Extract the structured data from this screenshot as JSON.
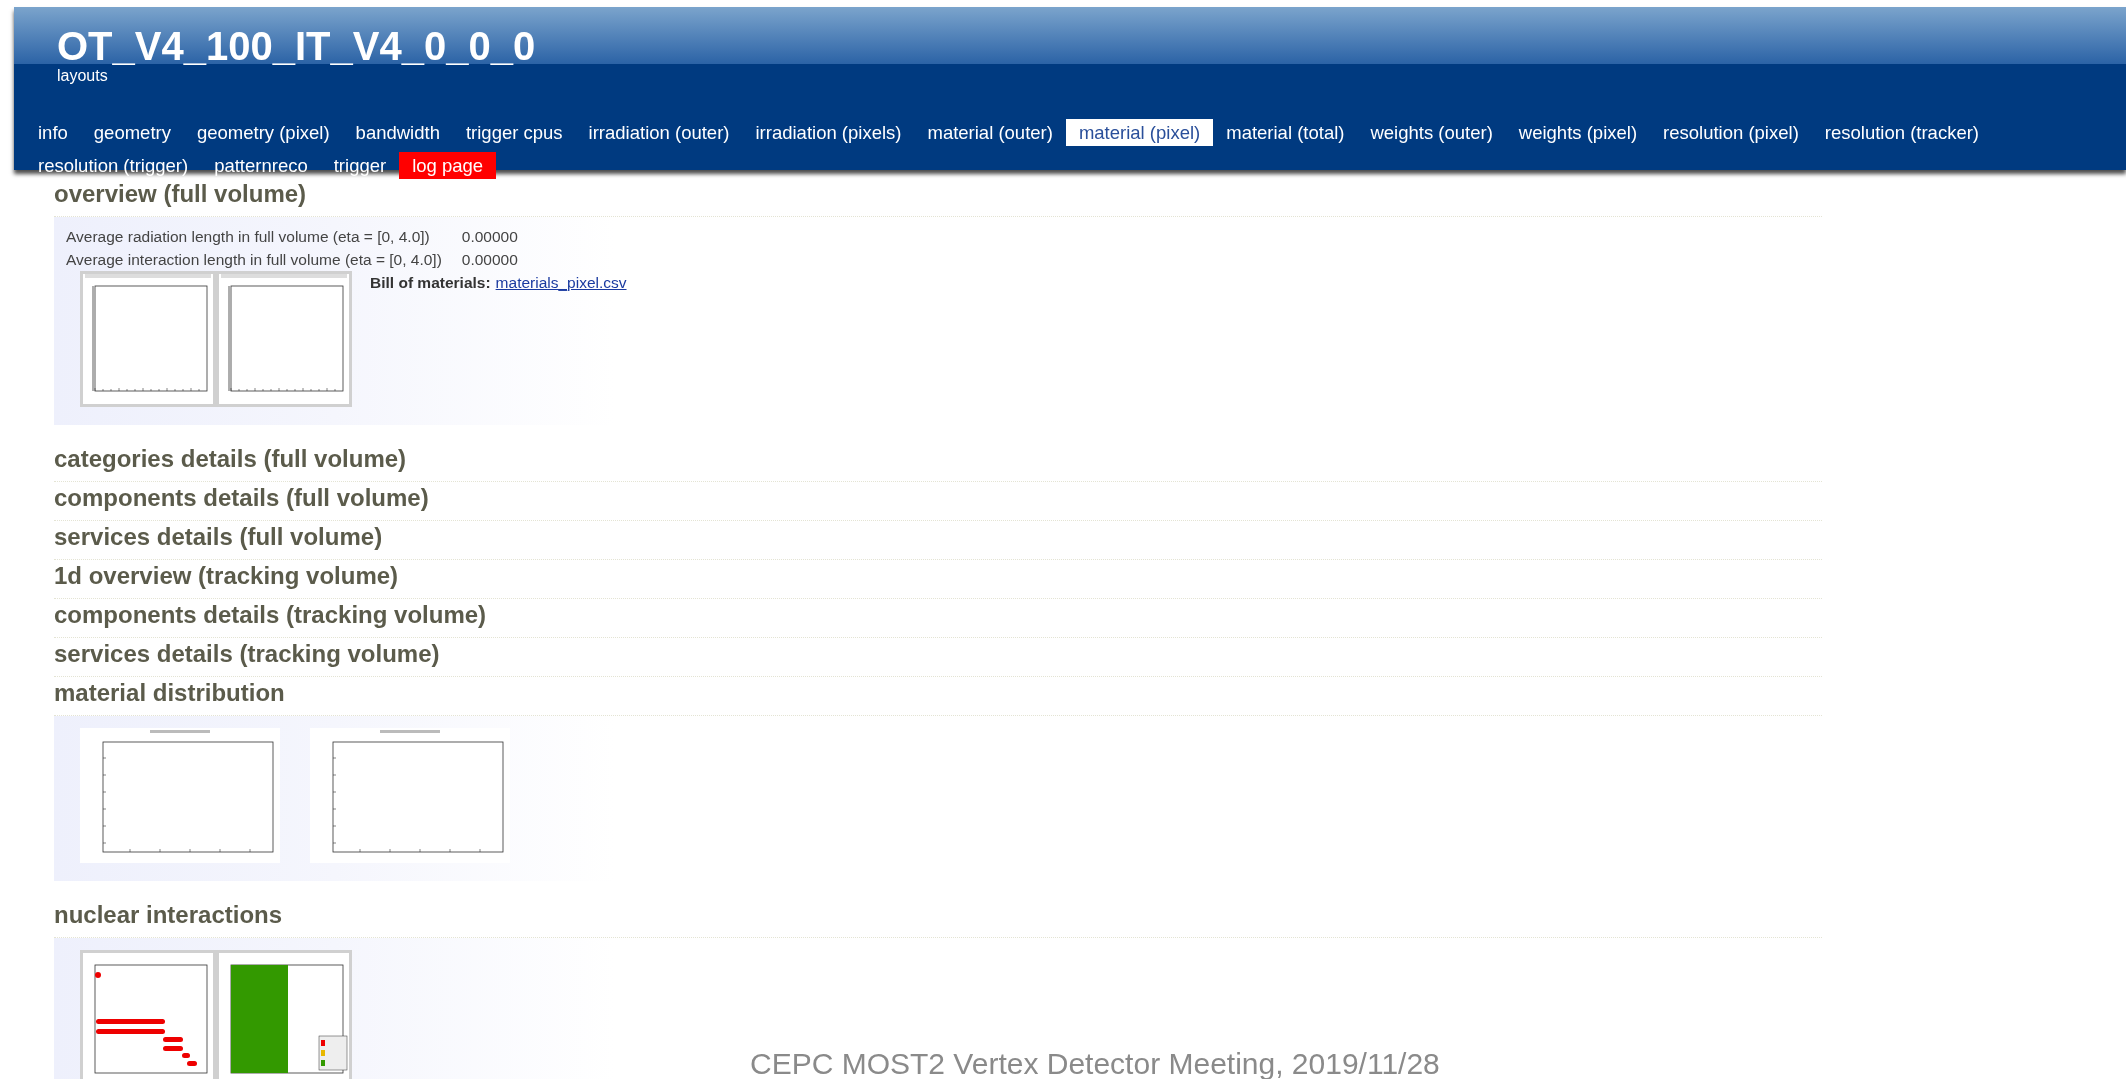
{
  "header": {
    "title": "OT_V4_100_IT_V4_0_0_0",
    "subtitle": "layouts"
  },
  "tabs": [
    {
      "label": "info",
      "selected": false,
      "kind": "page"
    },
    {
      "label": "geometry",
      "selected": false,
      "kind": "page"
    },
    {
      "label": "geometry (pixel)",
      "selected": false,
      "kind": "page"
    },
    {
      "label": "bandwidth",
      "selected": false,
      "kind": "page"
    },
    {
      "label": "trigger cpus",
      "selected": false,
      "kind": "page"
    },
    {
      "label": "irradiation (outer)",
      "selected": false,
      "kind": "page"
    },
    {
      "label": "irradiation (pixels)",
      "selected": false,
      "kind": "page"
    },
    {
      "label": "material (outer)",
      "selected": false,
      "kind": "page"
    },
    {
      "label": "material (pixel)",
      "selected": true,
      "kind": "page"
    },
    {
      "label": "material (total)",
      "selected": false,
      "kind": "page"
    },
    {
      "label": "weights (outer)",
      "selected": false,
      "kind": "page"
    },
    {
      "label": "weights (pixel)",
      "selected": false,
      "kind": "page"
    },
    {
      "label": "resolution (pixel)",
      "selected": false,
      "kind": "page"
    },
    {
      "label": "resolution (tracker)",
      "selected": false,
      "kind": "page"
    },
    {
      "label": "resolution (trigger)",
      "selected": false,
      "kind": "page"
    },
    {
      "label": "patternreco",
      "selected": false,
      "kind": "page"
    },
    {
      "label": "trigger",
      "selected": false,
      "kind": "page"
    },
    {
      "label": "log page",
      "selected": false,
      "kind": "log"
    }
  ],
  "sections": [
    {
      "heading": "overview (full volume)",
      "kind": "summary",
      "lines": [
        {
          "label": "Average radiation length in full volume (eta = [0, 4.0])",
          "value": "0.00000"
        },
        {
          "label": "Average interaction length in full volume (eta = [0, 4.0])",
          "value": "0.00000"
        }
      ],
      "figures": [
        {
          "kind": "profile"
        },
        {
          "kind": "profile"
        }
      ],
      "bill": {
        "label": "Bill of materials:",
        "link": "materials_pixel.csv"
      }
    },
    {
      "heading": "categories details (full volume)",
      "kind": "collapsed"
    },
    {
      "heading": "components details (full volume)",
      "kind": "collapsed"
    },
    {
      "heading": "services details (full volume)",
      "kind": "collapsed"
    },
    {
      "heading": "1d overview (tracking volume)",
      "kind": "collapsed"
    },
    {
      "heading": "components details (tracking volume)",
      "kind": "collapsed"
    },
    {
      "heading": "services details (tracking volume)",
      "kind": "collapsed"
    },
    {
      "heading": "material distribution",
      "kind": "gallery",
      "figures": [
        {
          "kind": "map"
        },
        {
          "kind": "map"
        }
      ]
    },
    {
      "heading": "nuclear interactions",
      "kind": "gallery",
      "figures": [
        {
          "kind": "points"
        },
        {
          "kind": "fraction"
        }
      ]
    }
  ],
  "footer_note": "CEPC MOST2 Vertex Detector Meeting, 2019/11/28"
}
